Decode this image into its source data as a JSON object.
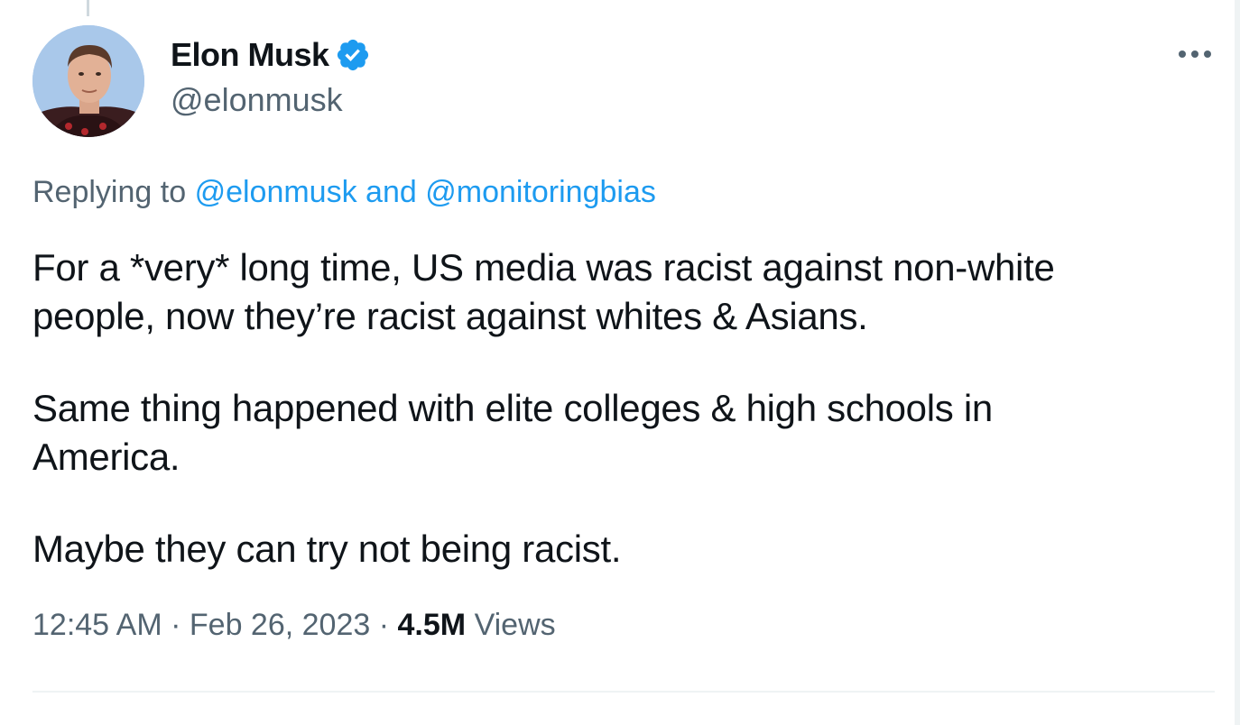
{
  "author": {
    "display_name": "Elon Musk",
    "handle": "@elonmusk",
    "verified": true,
    "verified_color": "#1d9bf0"
  },
  "reply": {
    "prefix": "Replying to",
    "mention_1": "@elonmusk",
    "conjunction": "and",
    "mention_2": "@monitoringbias"
  },
  "tweet": {
    "paragraphs": [
      "For a *very* long time, US media was racist against non-white\npeople, now they’re racist against whites & Asians.",
      "Same thing happened with elite colleges & high schools in\nAmerica.",
      "Maybe they can try not being racist."
    ]
  },
  "meta": {
    "time": "12:45 AM",
    "separator": "·",
    "date": "Feb 26, 2023",
    "views_count": "4.5M",
    "views_label": "Views"
  },
  "icons": {
    "more": "more-options-icon",
    "verified": "verified-badge-icon"
  },
  "colors": {
    "link": "#1d9bf0",
    "secondary_text": "#536471",
    "primary_text": "#0f1419"
  }
}
